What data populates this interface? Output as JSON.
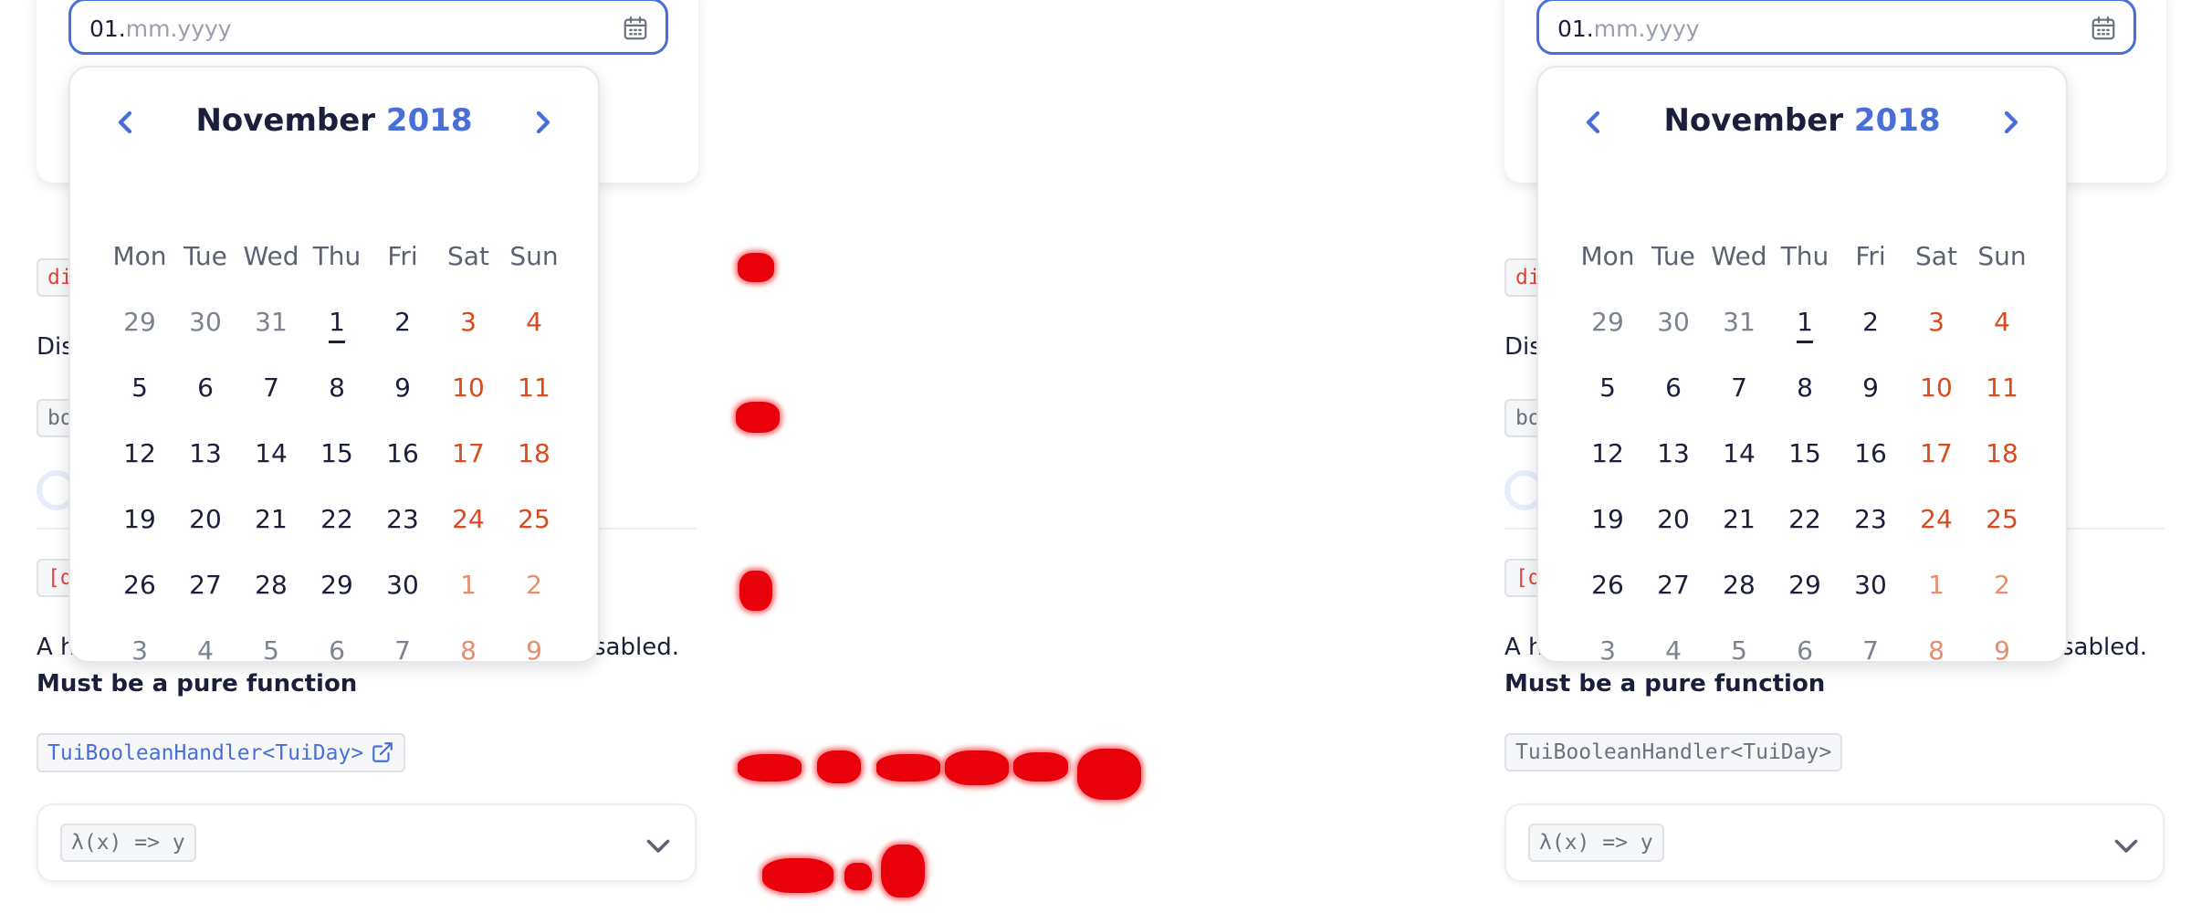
{
  "date_input": {
    "typed": "01.",
    "mask": "mm.yyyy"
  },
  "calendar": {
    "month": "November",
    "year": "2018",
    "weekdays": [
      "Mon",
      "Tue",
      "Wed",
      "Thu",
      "Fri",
      "Sat",
      "Sun"
    ],
    "rows": [
      [
        {
          "d": "29",
          "t": "other"
        },
        {
          "d": "30",
          "t": "other"
        },
        {
          "d": "31",
          "t": "other"
        },
        {
          "d": "1",
          "t": "today"
        },
        {
          "d": "2",
          "t": "normal"
        },
        {
          "d": "3",
          "t": "weekend"
        },
        {
          "d": "4",
          "t": "weekend"
        }
      ],
      [
        {
          "d": "5",
          "t": "normal"
        },
        {
          "d": "6",
          "t": "normal"
        },
        {
          "d": "7",
          "t": "normal"
        },
        {
          "d": "8",
          "t": "normal"
        },
        {
          "d": "9",
          "t": "normal"
        },
        {
          "d": "10",
          "t": "weekend"
        },
        {
          "d": "11",
          "t": "weekend"
        }
      ],
      [
        {
          "d": "12",
          "t": "normal"
        },
        {
          "d": "13",
          "t": "normal"
        },
        {
          "d": "14",
          "t": "normal"
        },
        {
          "d": "15",
          "t": "normal"
        },
        {
          "d": "16",
          "t": "normal"
        },
        {
          "d": "17",
          "t": "weekend"
        },
        {
          "d": "18",
          "t": "weekend"
        }
      ],
      [
        {
          "d": "19",
          "t": "normal"
        },
        {
          "d": "20",
          "t": "normal"
        },
        {
          "d": "21",
          "t": "normal"
        },
        {
          "d": "22",
          "t": "normal"
        },
        {
          "d": "23",
          "t": "normal"
        },
        {
          "d": "24",
          "t": "weekend"
        },
        {
          "d": "25",
          "t": "weekend"
        }
      ],
      [
        {
          "d": "26",
          "t": "normal"
        },
        {
          "d": "27",
          "t": "normal"
        },
        {
          "d": "28",
          "t": "normal"
        },
        {
          "d": "29",
          "t": "normal"
        },
        {
          "d": "30",
          "t": "normal"
        },
        {
          "d": "1",
          "t": "weekend-other"
        },
        {
          "d": "2",
          "t": "weekend-other"
        }
      ],
      [
        {
          "d": "3",
          "t": "other"
        },
        {
          "d": "4",
          "t": "other"
        },
        {
          "d": "5",
          "t": "other"
        },
        {
          "d": "6",
          "t": "other"
        },
        {
          "d": "7",
          "t": "other"
        },
        {
          "d": "8",
          "t": "weekend-other"
        },
        {
          "d": "9",
          "t": "weekend-other"
        }
      ]
    ]
  },
  "doc": {
    "chip_disabled": "di",
    "text_disabled": "Dis",
    "chip_boolean": "bo",
    "chip_disabled_item": "[d",
    "desc_left": "A h",
    "desc_right": "sabled.",
    "pure_function": "Must be a pure function",
    "type_chip": "TuiBooleanHandler<TuiDay>",
    "fn_chip": "λ(x) => y"
  },
  "colors": {
    "accent": "#4a6ed8",
    "weekend": "#d94a1e",
    "redaction": "#e8000b"
  }
}
